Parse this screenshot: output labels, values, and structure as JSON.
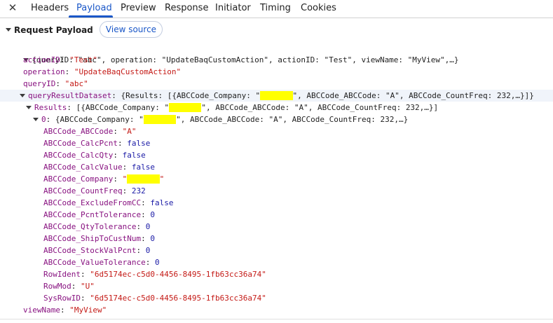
{
  "tabs": {
    "close_symbol": "✕",
    "items": [
      "Headers",
      "Payload",
      "Preview",
      "Response",
      "Initiator",
      "Timing",
      "Cookies"
    ],
    "active": "Payload"
  },
  "section": {
    "title": "Request Payload",
    "view_source": "View source"
  },
  "payload": {
    "root_summary": "{queryID: \"abc\", operation: \"UpdateBaqCustomAction\", actionID: \"Test\", viewName: \"MyView\",…}",
    "actionID": {
      "key": "actionID",
      "value": "\"Test\""
    },
    "operation": {
      "key": "operation",
      "value": "\"UpdateBaqCustomAction\""
    },
    "queryID": {
      "key": "queryID",
      "value": "\"abc\""
    },
    "queryResultDataset": {
      "key": "queryResultDataset",
      "summary_pre": "{Results: [{ABCCode_Company: \"",
      "summary_post": "\", ABCCode_ABCCode: \"A\", ABCCode_CountFreq: 232,…}]}"
    },
    "results": {
      "key": "Results",
      "summary_pre": "[{ABCCode_Company: \"",
      "summary_post": "\", ABCCode_ABCCode: \"A\", ABCCode_CountFreq: 232,…}]"
    },
    "item0": {
      "key": "0",
      "summary_pre": "{ABCCode_Company: \"",
      "summary_post": "\", ABCCode_ABCCode: \"A\", ABCCode_CountFreq: 232,…}"
    },
    "fields": [
      {
        "key": "ABCCode_ABCCode",
        "value": "\"A\"",
        "kind": "str"
      },
      {
        "key": "ABCCode_CalcPcnt",
        "value": "false",
        "kind": "lit"
      },
      {
        "key": "ABCCode_CalcQty",
        "value": "false",
        "kind": "lit"
      },
      {
        "key": "ABCCode_CalcValue",
        "value": "false",
        "kind": "lit"
      },
      {
        "key": "ABCCode_Company",
        "value": "",
        "kind": "redacted"
      },
      {
        "key": "ABCCode_CountFreq",
        "value": "232",
        "kind": "lit"
      },
      {
        "key": "ABCCode_ExcludeFromCC",
        "value": "false",
        "kind": "lit"
      },
      {
        "key": "ABCCode_PcntTolerance",
        "value": "0",
        "kind": "lit"
      },
      {
        "key": "ABCCode_QtyTolerance",
        "value": "0",
        "kind": "lit"
      },
      {
        "key": "ABCCode_ShipToCustNum",
        "value": "0",
        "kind": "lit"
      },
      {
        "key": "ABCCode_StockValPcnt",
        "value": "0",
        "kind": "lit"
      },
      {
        "key": "ABCCode_ValueTolerance",
        "value": "0",
        "kind": "lit"
      },
      {
        "key": "RowIdent",
        "value": "\"6d5174ec-c5d0-4456-8495-1fb63cc36a74\"",
        "kind": "str"
      },
      {
        "key": "RowMod",
        "value": "\"U\"",
        "kind": "str"
      },
      {
        "key": "SysRowID",
        "value": "\"6d5174ec-c5d0-4456-8495-1fb63cc36a74\"",
        "kind": "str"
      }
    ],
    "viewName": {
      "key": "viewName",
      "value": "\"MyView\""
    }
  },
  "colors": {
    "accent": "#1a57c8",
    "key": "#881280",
    "string": "#c41a16",
    "literal": "#1a1aa6",
    "redaction": "#ffff00"
  }
}
